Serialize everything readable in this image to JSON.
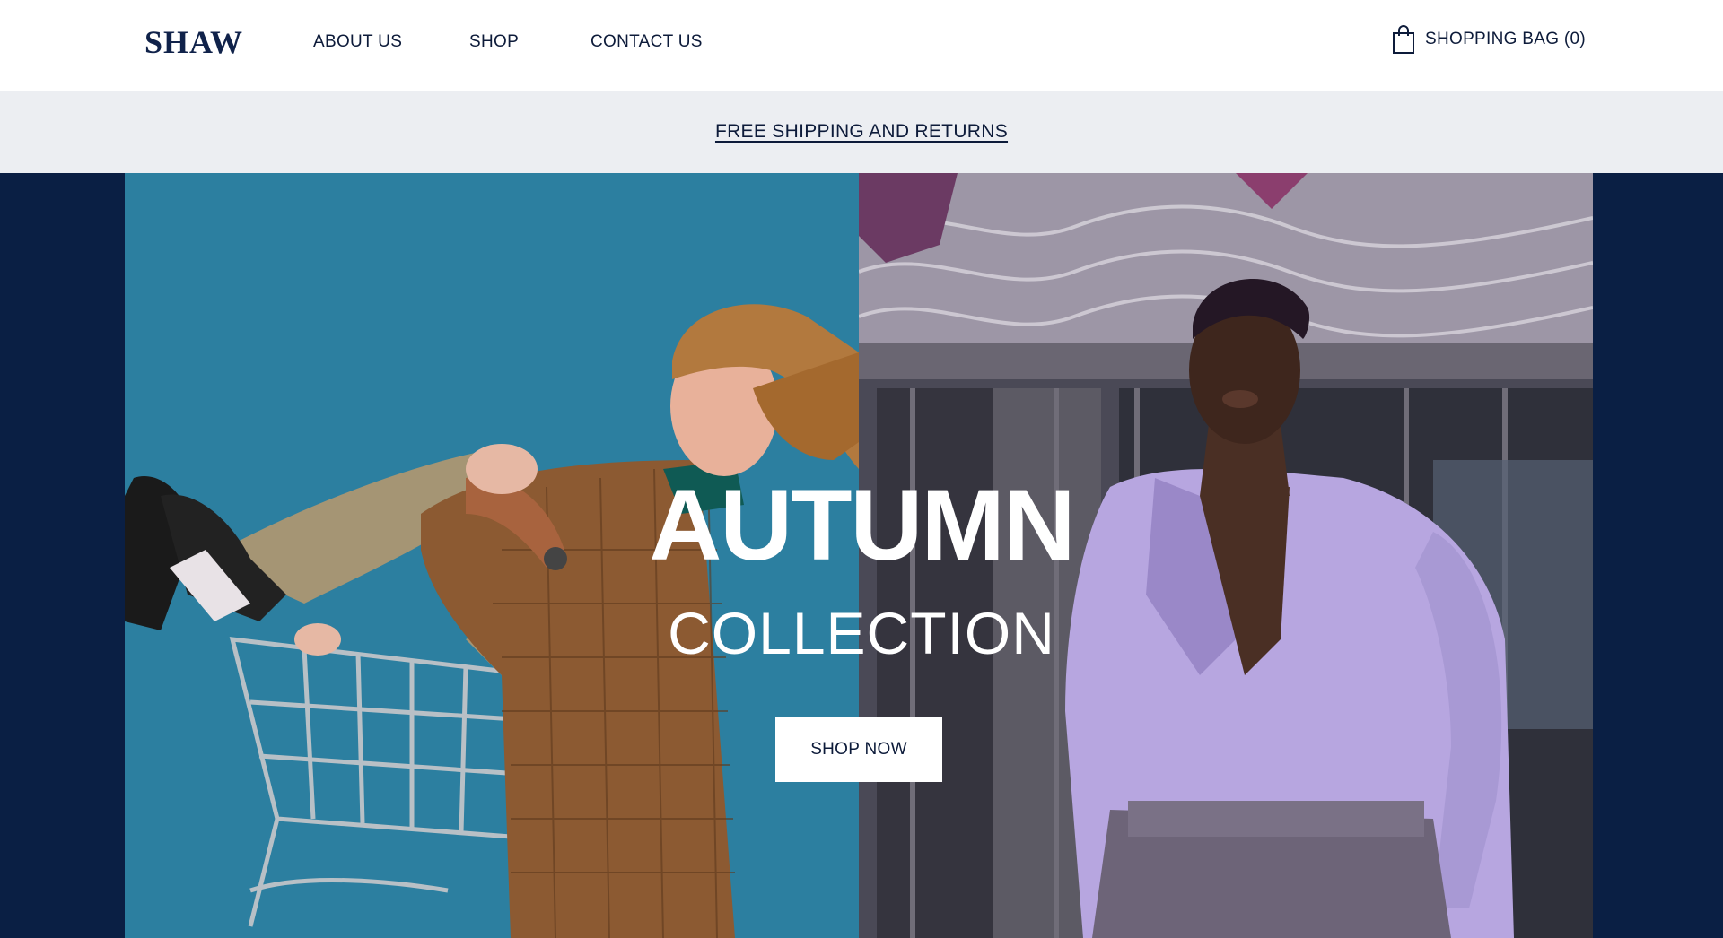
{
  "header": {
    "logo": "SHAW",
    "nav": [
      {
        "label": "ABOUT US"
      },
      {
        "label": "SHOP"
      },
      {
        "label": "CONTACT US"
      }
    ],
    "bag": {
      "icon": "shopping-bag-icon",
      "label": "SHOPPING BAG (0)"
    }
  },
  "promo": {
    "text": "FREE SHIPPING AND RETURNS"
  },
  "hero": {
    "title": "AUTUMN",
    "subtitle": "COLLECTION",
    "cta": "SHOP NOW"
  },
  "colors": {
    "brand_navy": "#10224a",
    "hero_background": "#0a1f44",
    "promo_background": "#eceef2",
    "left_photo_backdrop": "#2a7b9c"
  }
}
